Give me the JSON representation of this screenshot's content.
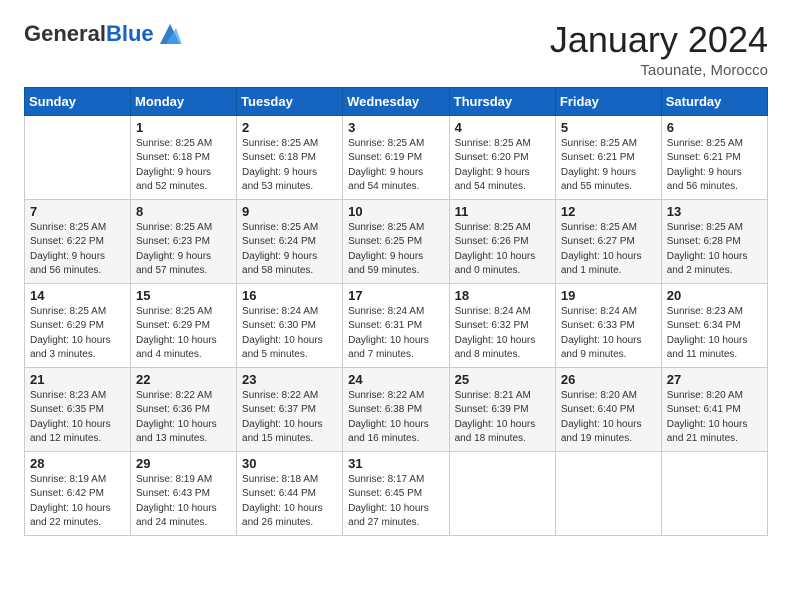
{
  "logo": {
    "general": "General",
    "blue": "Blue"
  },
  "header": {
    "month": "January 2024",
    "location": "Taounate, Morocco"
  },
  "weekdays": [
    "Sunday",
    "Monday",
    "Tuesday",
    "Wednesday",
    "Thursday",
    "Friday",
    "Saturday"
  ],
  "weeks": [
    [
      {
        "day": "",
        "info": ""
      },
      {
        "day": "1",
        "info": "Sunrise: 8:25 AM\nSunset: 6:18 PM\nDaylight: 9 hours\nand 52 minutes."
      },
      {
        "day": "2",
        "info": "Sunrise: 8:25 AM\nSunset: 6:18 PM\nDaylight: 9 hours\nand 53 minutes."
      },
      {
        "day": "3",
        "info": "Sunrise: 8:25 AM\nSunset: 6:19 PM\nDaylight: 9 hours\nand 54 minutes."
      },
      {
        "day": "4",
        "info": "Sunrise: 8:25 AM\nSunset: 6:20 PM\nDaylight: 9 hours\nand 54 minutes."
      },
      {
        "day": "5",
        "info": "Sunrise: 8:25 AM\nSunset: 6:21 PM\nDaylight: 9 hours\nand 55 minutes."
      },
      {
        "day": "6",
        "info": "Sunrise: 8:25 AM\nSunset: 6:21 PM\nDaylight: 9 hours\nand 56 minutes."
      }
    ],
    [
      {
        "day": "7",
        "info": "Sunrise: 8:25 AM\nSunset: 6:22 PM\nDaylight: 9 hours\nand 56 minutes."
      },
      {
        "day": "8",
        "info": "Sunrise: 8:25 AM\nSunset: 6:23 PM\nDaylight: 9 hours\nand 57 minutes."
      },
      {
        "day": "9",
        "info": "Sunrise: 8:25 AM\nSunset: 6:24 PM\nDaylight: 9 hours\nand 58 minutes."
      },
      {
        "day": "10",
        "info": "Sunrise: 8:25 AM\nSunset: 6:25 PM\nDaylight: 9 hours\nand 59 minutes."
      },
      {
        "day": "11",
        "info": "Sunrise: 8:25 AM\nSunset: 6:26 PM\nDaylight: 10 hours\nand 0 minutes."
      },
      {
        "day": "12",
        "info": "Sunrise: 8:25 AM\nSunset: 6:27 PM\nDaylight: 10 hours\nand 1 minute."
      },
      {
        "day": "13",
        "info": "Sunrise: 8:25 AM\nSunset: 6:28 PM\nDaylight: 10 hours\nand 2 minutes."
      }
    ],
    [
      {
        "day": "14",
        "info": "Sunrise: 8:25 AM\nSunset: 6:29 PM\nDaylight: 10 hours\nand 3 minutes."
      },
      {
        "day": "15",
        "info": "Sunrise: 8:25 AM\nSunset: 6:29 PM\nDaylight: 10 hours\nand 4 minutes."
      },
      {
        "day": "16",
        "info": "Sunrise: 8:24 AM\nSunset: 6:30 PM\nDaylight: 10 hours\nand 5 minutes."
      },
      {
        "day": "17",
        "info": "Sunrise: 8:24 AM\nSunset: 6:31 PM\nDaylight: 10 hours\nand 7 minutes."
      },
      {
        "day": "18",
        "info": "Sunrise: 8:24 AM\nSunset: 6:32 PM\nDaylight: 10 hours\nand 8 minutes."
      },
      {
        "day": "19",
        "info": "Sunrise: 8:24 AM\nSunset: 6:33 PM\nDaylight: 10 hours\nand 9 minutes."
      },
      {
        "day": "20",
        "info": "Sunrise: 8:23 AM\nSunset: 6:34 PM\nDaylight: 10 hours\nand 11 minutes."
      }
    ],
    [
      {
        "day": "21",
        "info": "Sunrise: 8:23 AM\nSunset: 6:35 PM\nDaylight: 10 hours\nand 12 minutes."
      },
      {
        "day": "22",
        "info": "Sunrise: 8:22 AM\nSunset: 6:36 PM\nDaylight: 10 hours\nand 13 minutes."
      },
      {
        "day": "23",
        "info": "Sunrise: 8:22 AM\nSunset: 6:37 PM\nDaylight: 10 hours\nand 15 minutes."
      },
      {
        "day": "24",
        "info": "Sunrise: 8:22 AM\nSunset: 6:38 PM\nDaylight: 10 hours\nand 16 minutes."
      },
      {
        "day": "25",
        "info": "Sunrise: 8:21 AM\nSunset: 6:39 PM\nDaylight: 10 hours\nand 18 minutes."
      },
      {
        "day": "26",
        "info": "Sunrise: 8:20 AM\nSunset: 6:40 PM\nDaylight: 10 hours\nand 19 minutes."
      },
      {
        "day": "27",
        "info": "Sunrise: 8:20 AM\nSunset: 6:41 PM\nDaylight: 10 hours\nand 21 minutes."
      }
    ],
    [
      {
        "day": "28",
        "info": "Sunrise: 8:19 AM\nSunset: 6:42 PM\nDaylight: 10 hours\nand 22 minutes."
      },
      {
        "day": "29",
        "info": "Sunrise: 8:19 AM\nSunset: 6:43 PM\nDaylight: 10 hours\nand 24 minutes."
      },
      {
        "day": "30",
        "info": "Sunrise: 8:18 AM\nSunset: 6:44 PM\nDaylight: 10 hours\nand 26 minutes."
      },
      {
        "day": "31",
        "info": "Sunrise: 8:17 AM\nSunset: 6:45 PM\nDaylight: 10 hours\nand 27 minutes."
      },
      {
        "day": "",
        "info": ""
      },
      {
        "day": "",
        "info": ""
      },
      {
        "day": "",
        "info": ""
      }
    ]
  ]
}
